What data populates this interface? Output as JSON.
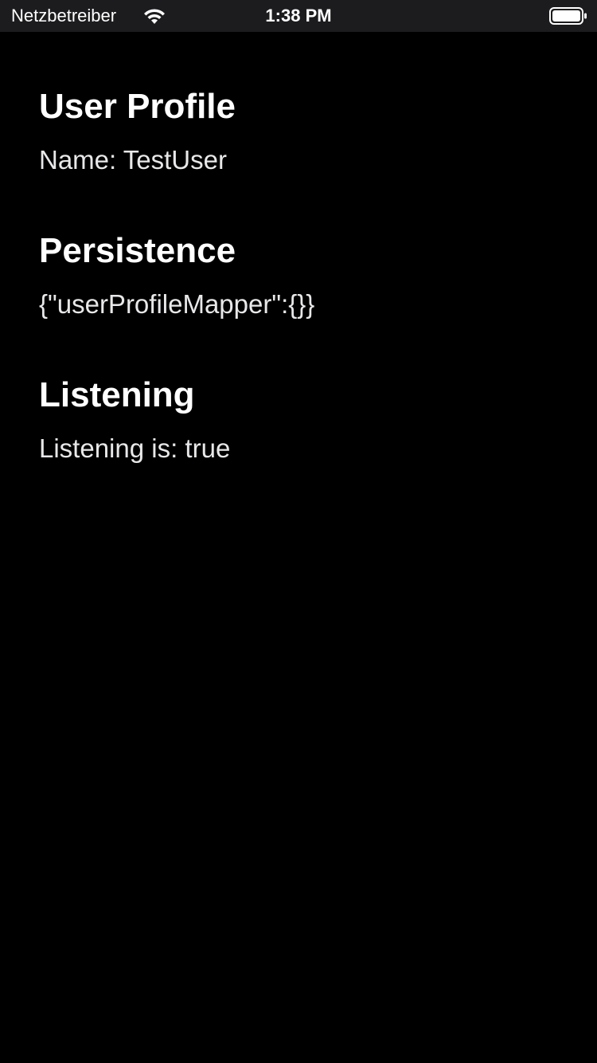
{
  "status_bar": {
    "carrier": "Netzbetreiber",
    "time": "1:38 PM",
    "wifi_icon": "wifi-icon",
    "battery_icon": "battery-icon"
  },
  "sections": {
    "user_profile": {
      "title": "User Profile",
      "text": "Name: TestUser"
    },
    "persistence": {
      "title": "Persistence",
      "text": "{\"userProfileMapper\":{}}"
    },
    "listening": {
      "title": "Listening",
      "text": "Listening is: true"
    }
  },
  "colors": {
    "background": "#000000",
    "status_bar_background": "#1c1c1e",
    "title_text": "#ffffff",
    "body_text": "#e8e8ea"
  }
}
